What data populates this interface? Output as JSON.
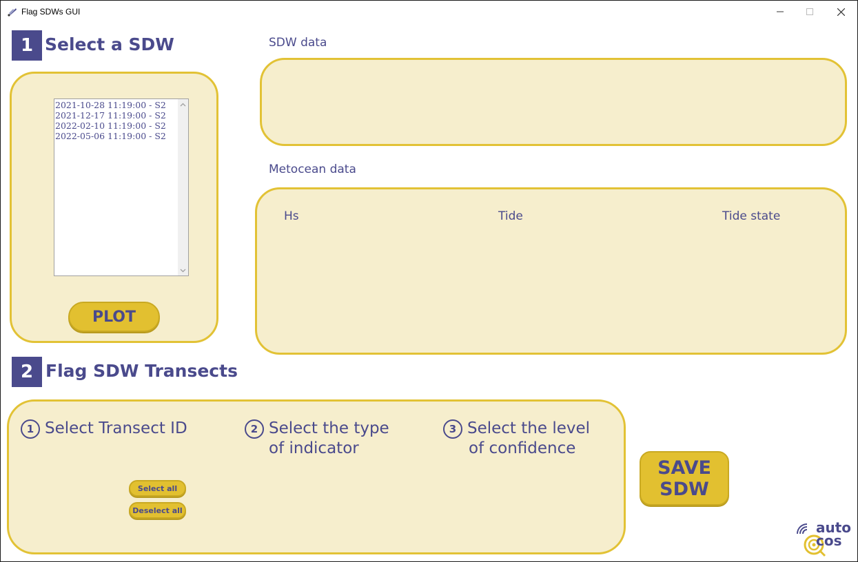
{
  "window": {
    "title": "Flag SDWs GUI"
  },
  "section1": {
    "number": "1",
    "title": "Select a SDW"
  },
  "sdw_list": {
    "items": [
      "2021-10-28 11:19:00 - S2",
      "2021-12-17 11:19:00 - S2",
      "2022-02-10 11:19:00 - S2",
      "2022-05-06 11:19:00 - S2"
    ]
  },
  "plot_button": "PLOT",
  "sdw_data": {
    "label": "SDW data"
  },
  "metocean": {
    "label": "Metocean data",
    "columns": [
      "Hs",
      "Tide",
      "Tide state"
    ]
  },
  "section2": {
    "number": "2",
    "title": "Flag SDW Transects"
  },
  "steps": [
    {
      "number": "1",
      "line1": "Select Transect ID",
      "line2": ""
    },
    {
      "number": "2",
      "line1": "Select the type",
      "line2": "of indicator"
    },
    {
      "number": "3",
      "line1": "Select the level",
      "line2": "of confidence"
    }
  ],
  "select_all": "Select all",
  "deselect_all": "Deselect all",
  "save_button": {
    "line1": "SAVE",
    "line2": "SDW"
  },
  "logo": {
    "line1": "auto",
    "line2": "cos"
  },
  "colors": {
    "accent": "#4a4a8c",
    "panel_bg": "#f6eecd",
    "panel_border": "#e2c235",
    "button": "#e2c030"
  }
}
